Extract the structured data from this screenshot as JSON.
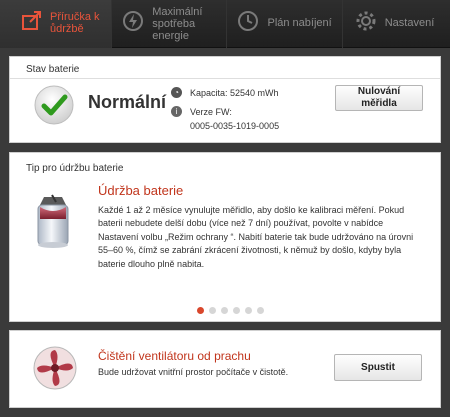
{
  "nav": {
    "tabs": [
      {
        "label": "Příručka k\nůdržbě",
        "icon": "maintenance-guide-icon",
        "active": true
      },
      {
        "label": "Maximální\nspotřeba\nenergie",
        "icon": "lightning-icon"
      },
      {
        "label": "Plán nabíjení",
        "icon": "clock-icon"
      },
      {
        "label": "Nastavení",
        "icon": "gear-icon"
      }
    ]
  },
  "battery_status": {
    "title": "Stav baterie",
    "status": "Normální",
    "capacity": "Kapacita: 52540 mWh",
    "fw_label": "Verze FW:",
    "fw_value": "0005-0035-1019-0005",
    "reset_button": "Nulování\nměřidla"
  },
  "tip": {
    "title": "Tip pro údržbu baterie",
    "heading": "Údržba baterie",
    "body": "Každé 1 až 2 měsíce vynulujte měřidlo, aby došlo ke kalibraci měření. Pokud baterii nebudete delší dobu (více než 7 dní) používat, povolte v nabídce Nastavení volbu „Režim ochrany “. Nabití baterie tak bude udržováno na úrovni 55–60 %, čímž se zabrání zkrácení životnosti, k němuž by došlo, kdyby byla baterie dlouho plně nabita.",
    "pages": 6,
    "current_page": 1
  },
  "fan": {
    "heading": "Čištění ventilátoru od prachu",
    "body": "Bude udržovat vnitřní prostor počítače v čistotě.",
    "button": "Spustit"
  },
  "colors": {
    "accent": "#c1351c",
    "ok_green": "#2f9a1e"
  }
}
